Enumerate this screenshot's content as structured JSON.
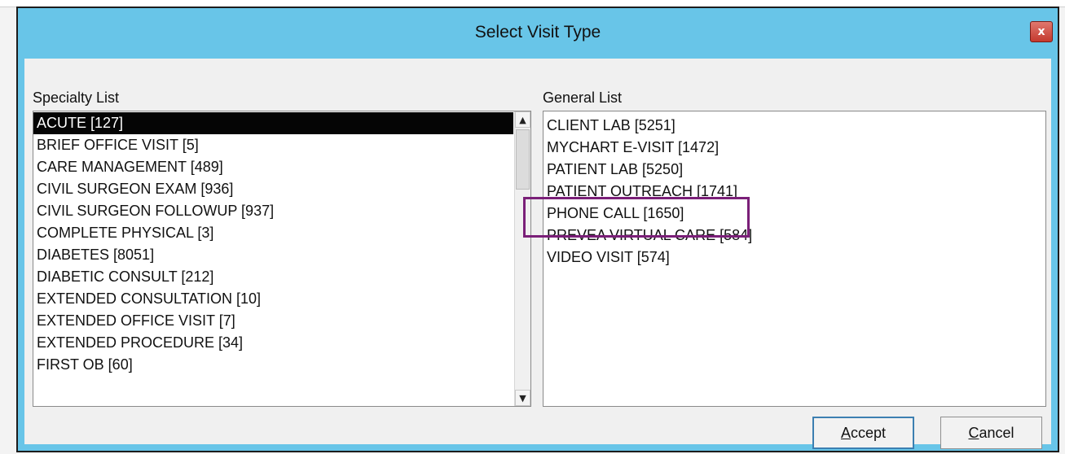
{
  "dialog": {
    "title": "Select Visit Type",
    "close_glyph": "x"
  },
  "specialty": {
    "label": "Specialty List",
    "items": [
      "ACUTE [127]",
      "BRIEF OFFICE VISIT [5]",
      "CARE MANAGEMENT [489]",
      "CIVIL SURGEON EXAM [936]",
      "CIVIL SURGEON FOLLOWUP [937]",
      "COMPLETE PHYSICAL [3]",
      "DIABETES [8051]",
      "DIABETIC CONSULT [212]",
      "EXTENDED CONSULTATION [10]",
      "EXTENDED OFFICE VISIT [7]",
      "EXTENDED PROCEDURE [34]",
      "FIRST OB [60]"
    ],
    "selected_index": 0,
    "scroll_up_glyph": "▲",
    "scroll_down_glyph": "▼"
  },
  "general": {
    "label": "General List",
    "items": [
      "CLIENT LAB [5251]",
      "MYCHART E-VISIT [1472]",
      "PATIENT LAB [5250]",
      "PATIENT OUTREACH [1741]",
      "PHONE CALL [1650]",
      "PREVEA VIRTUAL CARE [584]",
      "VIDEO VISIT [574]"
    ],
    "highlighted_index": 4
  },
  "buttons": {
    "accept_first": "A",
    "accept_rest": "ccept",
    "cancel_first": "C",
    "cancel_rest": "ancel"
  },
  "colors": {
    "title_bar": "#68c5e8",
    "highlight": "#7a1f78",
    "selection": "#050505"
  }
}
